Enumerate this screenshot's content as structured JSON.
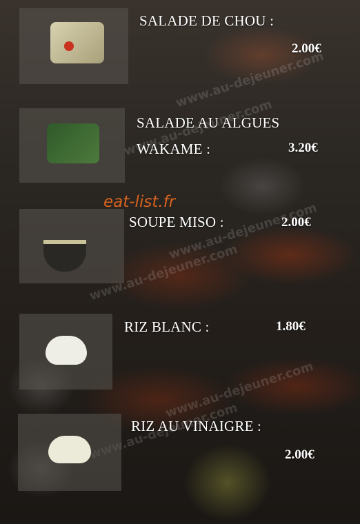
{
  "brand": "eat-list.fr",
  "watermark": "www.au-dejeuner.com",
  "items": [
    {
      "name_line1": "SALADE DE CHOU :",
      "name_line2": "",
      "price": "2.00€",
      "photo": "cabbage-salad-photo"
    },
    {
      "name_line1": "SALADE AU ALGUES",
      "name_line2": "WAKAME :",
      "price": "3.20€",
      "photo": "wakame-seaweed-salad-photo"
    },
    {
      "name_line1": "SOUPE MISO :",
      "name_line2": "",
      "price": "2.00€",
      "photo": "miso-soup-photo"
    },
    {
      "name_line1": "RIZ BLANC :",
      "name_line2": "",
      "price": "1.80€",
      "photo": "white-rice-photo"
    },
    {
      "name_line1": "RIZ AU VINAIGRE :",
      "name_line2": "",
      "price": "2.00€",
      "photo": "vinegar-rice-photo"
    }
  ]
}
